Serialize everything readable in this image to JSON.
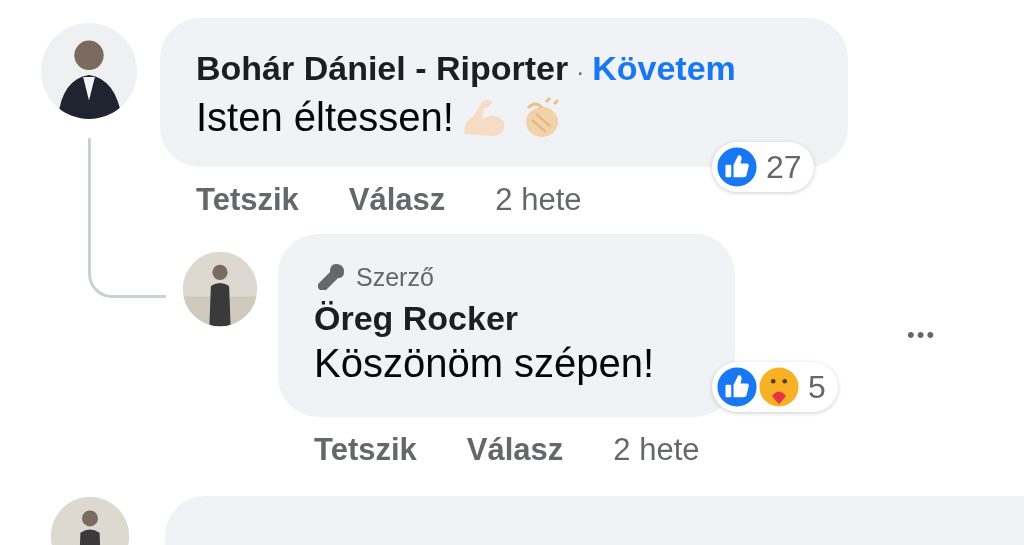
{
  "comments": [
    {
      "author": "Bohár Dániel - Riporter",
      "separator": "·",
      "follow": "Követem",
      "text": "Isten éltessen!",
      "emojis": [
        {
          "kind": "muscle"
        },
        {
          "kind": "clap"
        }
      ],
      "reactions": [
        {
          "kind": "like"
        }
      ],
      "reaction_count": "27",
      "actions": [
        {
          "label": "Tetszik"
        },
        {
          "label": "Válasz"
        }
      ],
      "time": "2 hete",
      "replies": [
        {
          "badge": "Szerző",
          "author": "Öreg Rocker",
          "text": "Köszönöm szépen!",
          "reactions": [
            {
              "kind": "like"
            },
            {
              "kind": "care"
            }
          ],
          "reaction_count": "5",
          "actions": [
            {
              "label": "Tetszik"
            },
            {
              "label": "Válasz"
            }
          ],
          "time": "2 hete",
          "more": "•••"
        }
      ]
    }
  ]
}
